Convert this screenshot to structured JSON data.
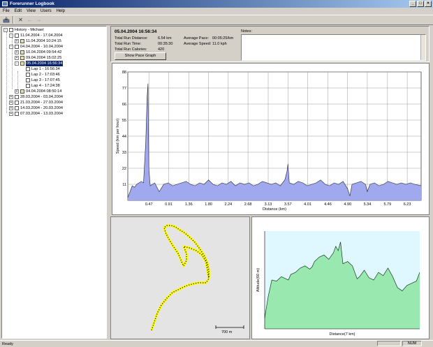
{
  "window": {
    "title": "Forerunner Logbook",
    "min": "_",
    "max": "□",
    "close": "×"
  },
  "menu": [
    "File",
    "Edit",
    "View",
    "Users",
    "Help"
  ],
  "toolbar": {
    "open_icon": "open-icon",
    "delete": "✕",
    "back": "←",
    "forward": "→"
  },
  "tree": [
    {
      "label": "History - Michael",
      "depth": 0,
      "exp": "-",
      "icon": "user"
    },
    {
      "label": "11.04.2004 - 17.04.2004",
      "depth": 1,
      "exp": "-",
      "icon": "week"
    },
    {
      "label": "11.04.2004 10:24:15",
      "depth": 2,
      "exp": "+",
      "icon": "run"
    },
    {
      "label": "04.04.2004 - 10.04.2004",
      "depth": 1,
      "exp": "-",
      "icon": "week"
    },
    {
      "label": "10.04.2004 09:54:42",
      "depth": 2,
      "exp": "+",
      "icon": "run"
    },
    {
      "label": "09.04.2004 15:02:25",
      "depth": 2,
      "exp": "+",
      "icon": "run"
    },
    {
      "label": "05.04.2004 16:56:34",
      "depth": 2,
      "exp": "-",
      "icon": "run",
      "selected": true
    },
    {
      "label": "Lap 1 - 16:56:34",
      "depth": 3,
      "exp": "",
      "icon": "lap"
    },
    {
      "label": "Lap 2 - 17:03:46",
      "depth": 3,
      "exp": "",
      "icon": "lap"
    },
    {
      "label": "Lap 3 - 17:07:45",
      "depth": 3,
      "exp": "",
      "icon": "lap"
    },
    {
      "label": "Lap 4 - 17:24:38",
      "depth": 3,
      "exp": "",
      "icon": "lap"
    },
    {
      "label": "04.04.2004 08:50:14",
      "depth": 2,
      "exp": "+",
      "icon": "run"
    },
    {
      "label": "28.03.2004 - 03.04.2004",
      "depth": 1,
      "exp": "+",
      "icon": "week"
    },
    {
      "label": "21.03.2004 - 27.03.2004",
      "depth": 1,
      "exp": "+",
      "icon": "week"
    },
    {
      "label": "14.03.2004 - 20.03.2004",
      "depth": 1,
      "exp": "+",
      "icon": "week"
    },
    {
      "label": "07.03.2004 - 13.03.2004",
      "depth": 1,
      "exp": "+",
      "icon": "week"
    }
  ],
  "summary": {
    "date": "05.04.2004   16:56:34",
    "distance_label": "Total Run Distance:",
    "distance": "6.54 km",
    "time_label": "Total Run Time:",
    "time": "00:35:30",
    "calories_label": "Total Run Calories:",
    "calories": "420",
    "pace_label": "Average Pace:",
    "pace": "00:05:25/km",
    "speed_label": "Average Speed:",
    "speed": "11.0 kph",
    "notes_label": "Notes:",
    "pace_button": "Show Pace Graph"
  },
  "chart_data": [
    {
      "type": "area",
      "ylabel": "Speed (km per hour)",
      "xlabel": "Distance (km)",
      "yticks": [
        "88",
        "77",
        "66",
        "55",
        "44",
        "33",
        "22",
        "11"
      ],
      "xticks": [
        "0.47",
        "0.91",
        "1.36",
        "1.80",
        "2.24",
        "2.68",
        "3.13",
        "3.57",
        "4.01",
        "4.46",
        "4.90",
        "5.34",
        "5.79",
        "6.23"
      ],
      "ylim": [
        0,
        88
      ],
      "xlim": [
        0,
        6.54
      ],
      "grid": true,
      "color": "#a0a8ee",
      "x": [
        0,
        0.05,
        0.1,
        0.15,
        0.2,
        0.25,
        0.3,
        0.35,
        0.4,
        0.43,
        0.45,
        0.47,
        0.5,
        0.55,
        0.6,
        0.65,
        0.7,
        0.8,
        0.9,
        1.0,
        1.1,
        1.2,
        1.3,
        1.4,
        1.5,
        1.6,
        1.7,
        1.8,
        1.9,
        2.0,
        2.1,
        2.2,
        2.3,
        2.4,
        2.5,
        2.6,
        2.7,
        2.8,
        2.9,
        3.0,
        3.1,
        3.2,
        3.3,
        3.4,
        3.5,
        3.55,
        3.57,
        3.6,
        3.7,
        3.8,
        3.9,
        4.0,
        4.1,
        4.2,
        4.3,
        4.4,
        4.5,
        4.6,
        4.7,
        4.8,
        4.9,
        4.95,
        5.0,
        5.1,
        5.2,
        5.3,
        5.34,
        5.4,
        5.5,
        5.6,
        5.7,
        5.8,
        5.9,
        6.0,
        6.1,
        6.2,
        6.3,
        6.4,
        6.54
      ],
      "y": [
        2,
        6,
        10,
        9,
        11,
        12,
        13,
        12,
        40,
        70,
        80,
        22,
        10,
        11,
        12,
        9,
        6,
        11,
        12,
        10,
        11,
        12,
        13,
        11,
        10,
        12,
        11,
        14,
        11,
        10,
        12,
        11,
        13,
        10,
        12,
        11,
        12,
        10,
        11,
        13,
        12,
        11,
        12,
        10,
        14,
        20,
        25,
        12,
        11,
        13,
        12,
        10,
        11,
        12,
        14,
        11,
        10,
        12,
        11,
        13,
        8,
        3,
        11,
        12,
        13,
        11,
        6,
        11,
        12,
        10,
        11,
        13,
        12,
        11,
        12,
        11,
        12,
        11,
        10
      ]
    },
    {
      "type": "area",
      "ylabel": "Altitude(60 m)",
      "xlabel": "Distance(7 km)",
      "color": "#98e8b0",
      "x": [
        0,
        0.15,
        0.3,
        0.5,
        0.7,
        0.9,
        1.0,
        1.1,
        1.3,
        1.5,
        1.7,
        1.9,
        2.0,
        2.1,
        2.3,
        2.5,
        2.7,
        2.9,
        3.0,
        3.1,
        3.2,
        3.3,
        3.5,
        3.7,
        3.9,
        4.0,
        4.2,
        4.4,
        4.6,
        4.8,
        5.0,
        5.2,
        5.4,
        5.6,
        5.8,
        6.0,
        6.2,
        6.4,
        6.54
      ],
      "y": [
        10,
        30,
        45,
        44,
        48,
        46,
        45,
        50,
        52,
        56,
        58,
        55,
        57,
        62,
        66,
        68,
        64,
        70,
        76,
        72,
        80,
        60,
        62,
        58,
        46,
        48,
        54,
        47,
        45,
        52,
        49,
        56,
        48,
        38,
        35,
        40,
        42,
        44,
        52
      ]
    }
  ],
  "map": {
    "scale_label": "700 m"
  },
  "status": {
    "text": "Ready",
    "num": "NUM"
  }
}
